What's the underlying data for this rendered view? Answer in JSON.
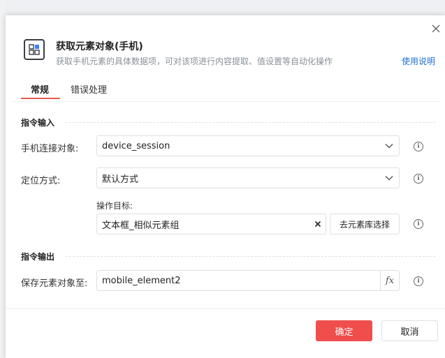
{
  "dialog": {
    "title": "获取元素对象(手机)",
    "subtitle": "获取手机元素的具体数据项，可对该项进行内容提取、值设置等自动化操作",
    "help_link": "使用说明"
  },
  "tabs": [
    {
      "label": "常规",
      "active": true
    },
    {
      "label": "错误处理",
      "active": false
    }
  ],
  "sections": {
    "input_title": "指令输入",
    "output_title": "指令输出"
  },
  "fields": {
    "device": {
      "label": "手机连接对象:",
      "value": "device_session"
    },
    "locate": {
      "label": "定位方式:",
      "value": "默认方式"
    },
    "target": {
      "label": "操作目标:",
      "value": "文本框_相似元素组",
      "pick_button": "去元素库选择"
    },
    "save": {
      "label": "保存元素对象至:",
      "value": "mobile_element2"
    }
  },
  "footer": {
    "ok_label": "确定",
    "cancel_label": "取消"
  },
  "colors": {
    "accent": "#f04d4d",
    "link": "#1f6fd6"
  }
}
